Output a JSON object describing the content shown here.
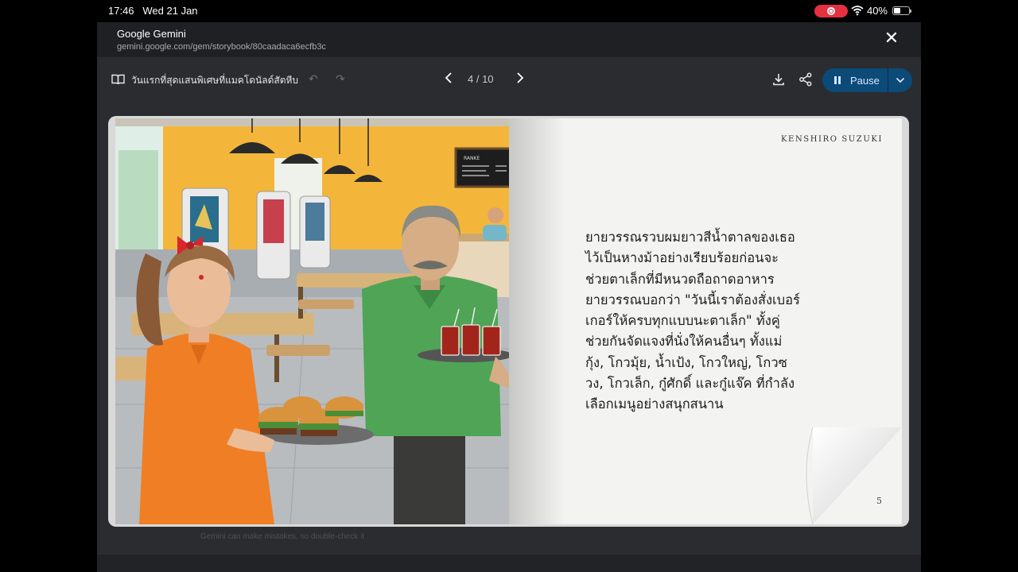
{
  "status": {
    "time": "17:46",
    "date": "Wed 21 Jan",
    "battery": "40%",
    "record_icon": "screen-record-icon",
    "wifi_icon": "wifi-icon",
    "battery_icon": "battery-icon"
  },
  "browser": {
    "title": "Google Gemini",
    "url": "gemini.google.com/gem/storybook/80caadaca6ecfb3c",
    "close_icon": "close-icon"
  },
  "toolbar": {
    "book_title": "วันแรกที่สุดแสนพิเศษที่แมคโดนัลด์สัตหีบ",
    "book_icon": "book-icon",
    "undo_icon": "undo-icon",
    "redo_icon": "redo-icon",
    "page_indicator": "4 / 10",
    "download_icon": "download-icon",
    "share_icon": "share-icon",
    "pause_label": "Pause",
    "chevron_icon": "chevron-down-icon"
  },
  "book": {
    "author": "KENSHIRO SUZUKI",
    "lines": [
      "ยายวรรณรวบผมยาวสีน้ำตาลของเธอ",
      "ไว้เป็นหางม้าอย่างเรียบร้อยก่อนจะ",
      "ช่วยตาเล็กที่มีหนวดถือถาดอาหาร",
      "ยายวรรณบอกว่า \"วันนี้เราต้องสั่งเบอร์",
      "เกอร์ให้ครบทุกแบบนะตาเล็ก\" ทั้งคู่",
      "ช่วยกันจัดแจงที่นั่งให้คนอื่นๆ ทั้งแม่",
      "กุ้ง, โกวมุ้ย, น้ำเป้ง, โกวใหญ่, โกวซ",
      "วง, โกวเล็ก, กู๋ศักดิ์ และกู๋แจ๊ค ที่กำลัง",
      "เลือกเมนูอย่างสนุกสนาน"
    ],
    "page_number": "5",
    "illustration": {
      "menu_board_text": "RANKE",
      "colors": {
        "wall": "#f3b63a",
        "floor": "#b9bcbf",
        "woman_shirt": "#f07e25",
        "man_shirt": "#4fa455",
        "bow": "#d9262b"
      }
    }
  },
  "footer": {
    "disclaimer": "Gemini can make mistakes, so double-check it"
  }
}
